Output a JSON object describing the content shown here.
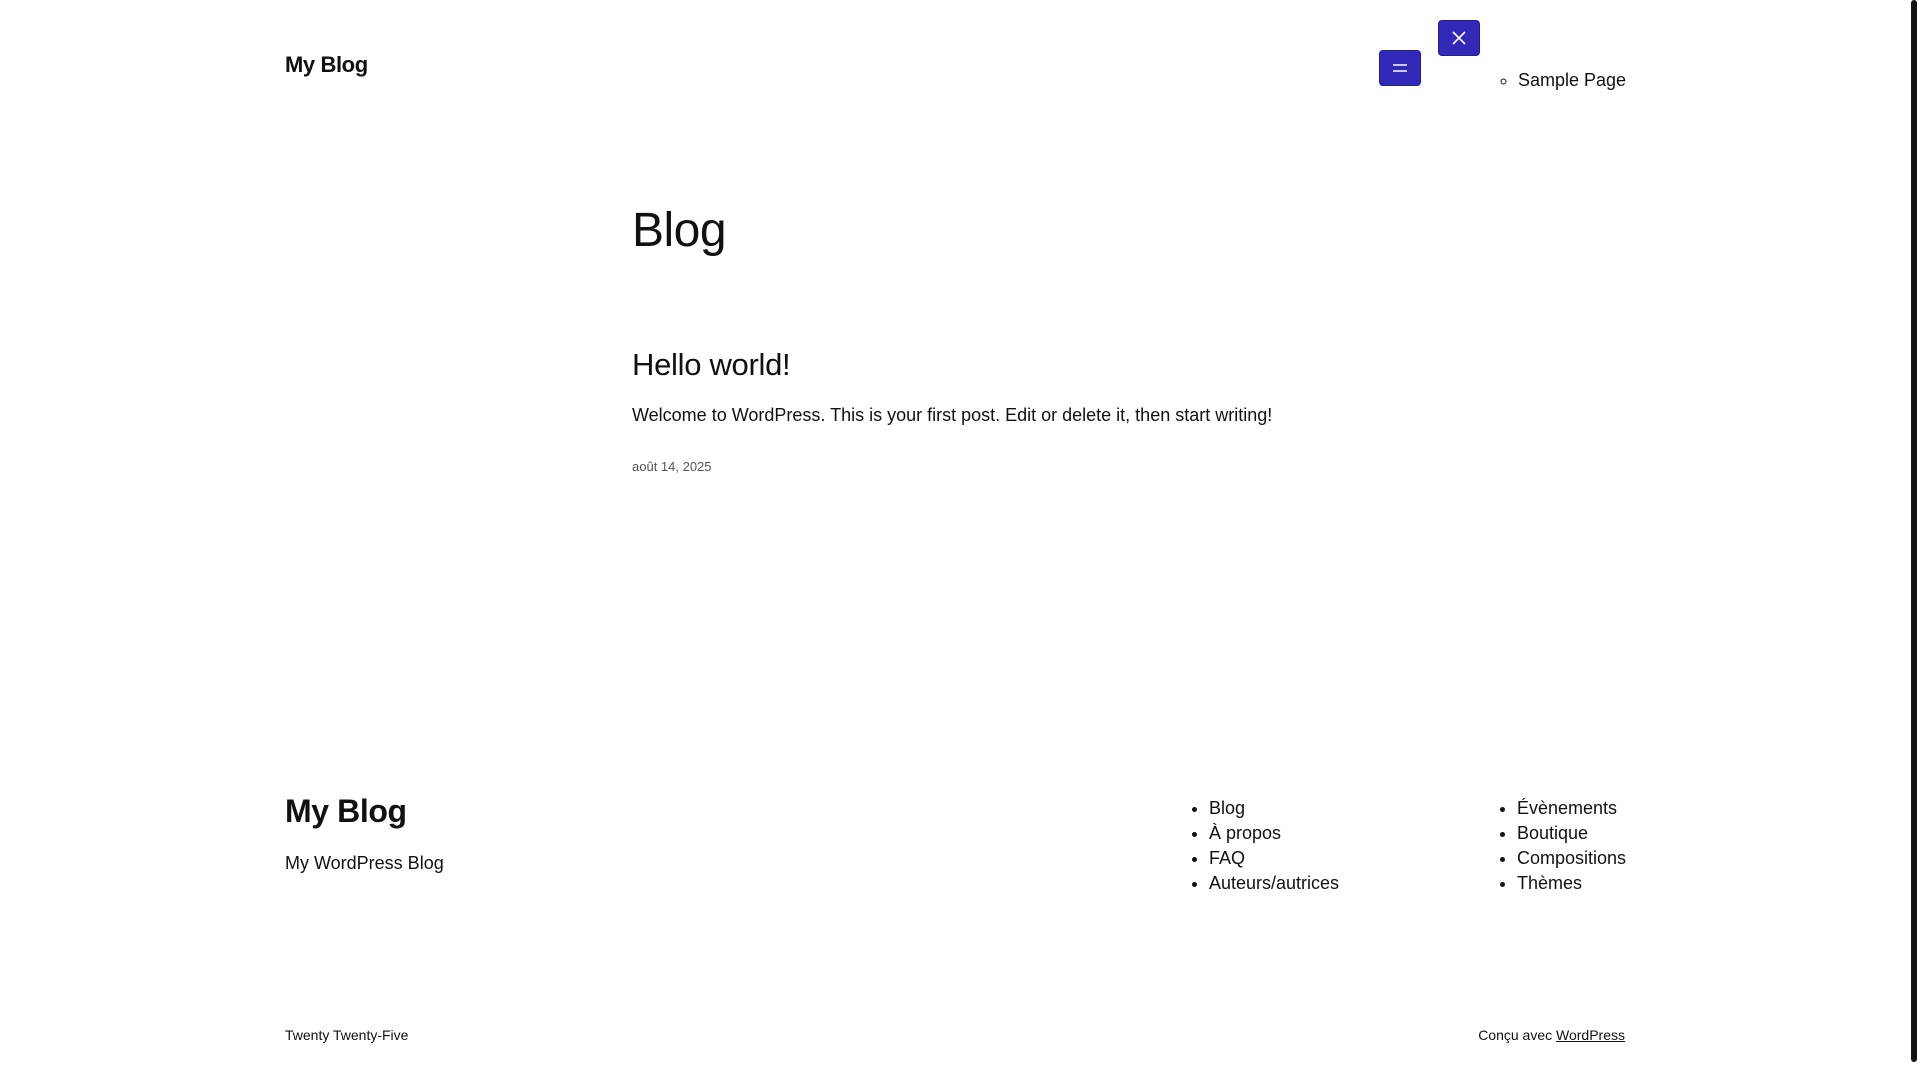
{
  "header": {
    "site_title": "My Blog",
    "menu_open_icon": "hamburger-icon",
    "menu_close_icon": "close-icon",
    "nav_items": [
      {
        "label": "Sample Page"
      }
    ]
  },
  "main": {
    "page_heading": "Blog",
    "posts": [
      {
        "title": "Hello world!",
        "excerpt": "Welcome to WordPress. This is your first post. Edit or delete it, then start writing!",
        "date": "août 14, 2025"
      }
    ]
  },
  "footer": {
    "site_title": "My Blog",
    "tagline": "My WordPress Blog",
    "nav_col_1": [
      {
        "label": "Blog"
      },
      {
        "label": "À propos"
      },
      {
        "label": "FAQ"
      },
      {
        "label": "Auteurs/autrices"
      }
    ],
    "nav_col_2": [
      {
        "label": "Évènements"
      },
      {
        "label": "Boutique"
      },
      {
        "label": "Compositions"
      },
      {
        "label": "Thèmes"
      }
    ],
    "theme_credit": "Twenty Twenty-Five",
    "designed_with": "Conçu avec",
    "wordpress_link": "WordPress"
  },
  "colors": {
    "button_bg": "#3229b9",
    "text": "#111111",
    "date_text": "#555555"
  }
}
